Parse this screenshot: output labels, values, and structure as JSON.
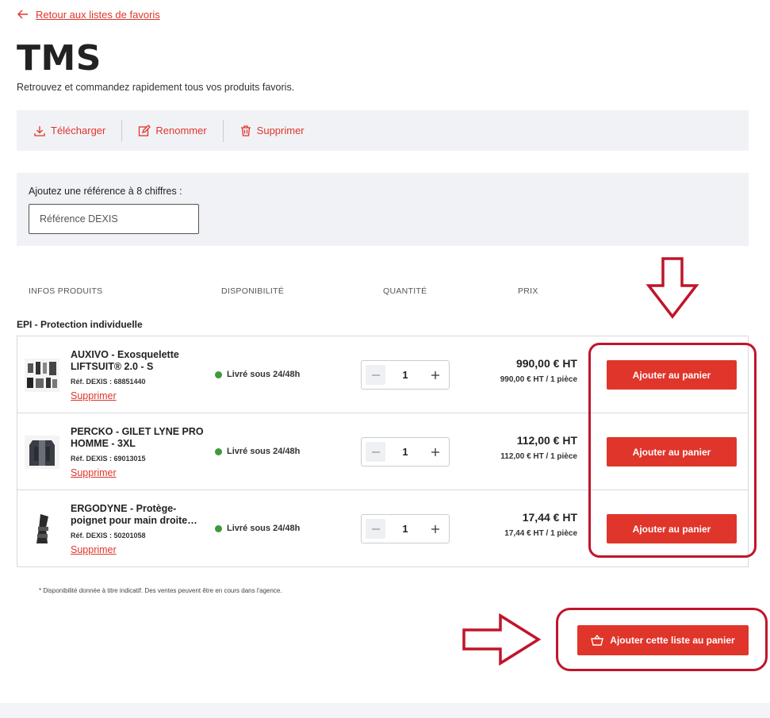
{
  "nav": {
    "back_label": "Retour aux listes de favoris"
  },
  "header": {
    "title": "TMS",
    "subtitle": "Retrouvez et commandez rapidement tous vos produits favoris."
  },
  "toolbar": {
    "download_label": "Télécharger",
    "rename_label": "Renommer",
    "delete_label": "Supprimer"
  },
  "reference": {
    "label": "Ajoutez une référence à 8 chiffres :",
    "placeholder": "Référence DEXIS"
  },
  "columns": {
    "infos": "INFOS PRODUITS",
    "availability": "DISPONIBILITÉ",
    "quantity": "QUANTITÉ",
    "price": "PRIX"
  },
  "group": {
    "title": "EPI - Protection individuelle"
  },
  "products": [
    {
      "name": "AUXIVO - Exosquelette LIFTSUIT® 2.0 - S",
      "ref": "Réf. DEXIS : 68851440",
      "delete_label": "Supprimer",
      "availability": "Livré sous 24/48h",
      "quantity": "1",
      "price": "990,00 € HT",
      "unit_price": "990,00 € HT / 1 pièce",
      "add_label": "Ajouter au panier",
      "thumb_icon": "exoskeleton-thumbnail"
    },
    {
      "name": "PERCKO - GILET LYNE PRO HOMME - 3XL",
      "ref": "Réf. DEXIS : 69013015",
      "delete_label": "Supprimer",
      "availability": "Livré sous 24/48h",
      "quantity": "1",
      "price": "112,00 € HT",
      "unit_price": "112,00 € HT / 1 pièce",
      "add_label": "Ajouter au panier",
      "thumb_icon": "vest-thumbnail"
    },
    {
      "name": "ERGODYNE - Protège-poignet pour main droite…",
      "ref": "Réf. DEXIS : 50201058",
      "delete_label": "Supprimer",
      "availability": "Livré sous 24/48h",
      "quantity": "1",
      "price": "17,44 € HT",
      "unit_price": "17,44 € HT / 1 pièce",
      "add_label": "Ajouter au panier",
      "thumb_icon": "wrist-brace-thumbnail"
    }
  ],
  "footnote": "* Disponibilité donnée à titre indicatif. Des ventes peuvent être en cours dans l'agence.",
  "actions": {
    "add_list_label": "Ajouter cette liste au panier"
  },
  "colors": {
    "accent": "#e0352b",
    "available": "#3e9a3b",
    "annotation": "#c0152a",
    "panel": "#f1f2f6"
  }
}
